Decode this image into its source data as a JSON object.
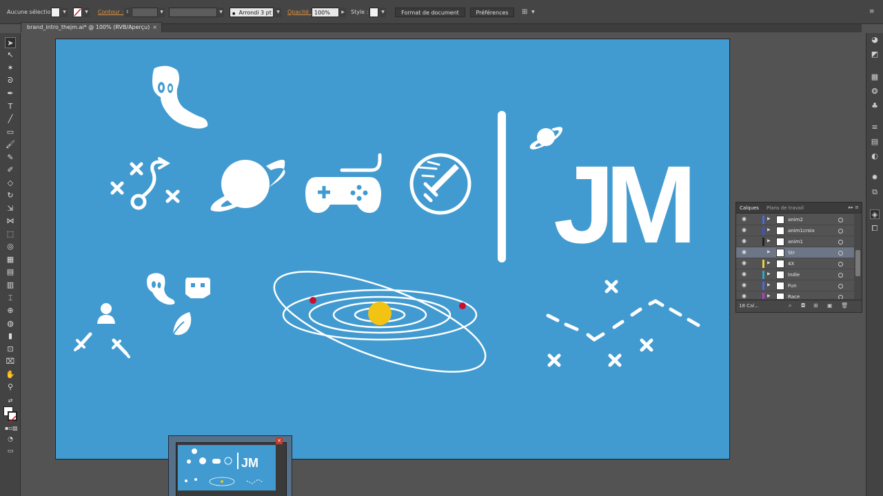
{
  "controlbar": {
    "selection_label": "Aucune sélection",
    "stroke_label": "Contour :",
    "profile_value": "Arrondi 3 pt",
    "opacity_label": "Opacité :",
    "opacity_value": "100%",
    "style_label": "Style :",
    "doc_format_button": "Format de document",
    "prefs_button": "Préférences"
  },
  "document_tab": {
    "title": "brand_intro_thejm.ai* @ 100% (RVB/Aperçu)",
    "close": "×"
  },
  "artboard": {
    "background": "#429bd0",
    "logo_text": "JM",
    "accent_sun": "#f2c313",
    "accent_dots": "#c8102e"
  },
  "layers_panel": {
    "tab_layers": "Calques",
    "tab_artboards": "Plans de travail",
    "rows": [
      {
        "name": "anim2",
        "color": "#4a6ae0"
      },
      {
        "name": "anim1croix",
        "color": "#3b55c8"
      },
      {
        "name": "anim1",
        "color": "#222222"
      },
      {
        "name": "Str",
        "color": "#6c7686"
      },
      {
        "name": "4X",
        "color": "#e6d23a"
      },
      {
        "name": "Indie",
        "color": "#2fa7c9"
      },
      {
        "name": "Fun",
        "color": "#4a6ae0"
      },
      {
        "name": "Race",
        "color": "#b43ad8"
      }
    ],
    "footer_count": "18 Cal..."
  }
}
